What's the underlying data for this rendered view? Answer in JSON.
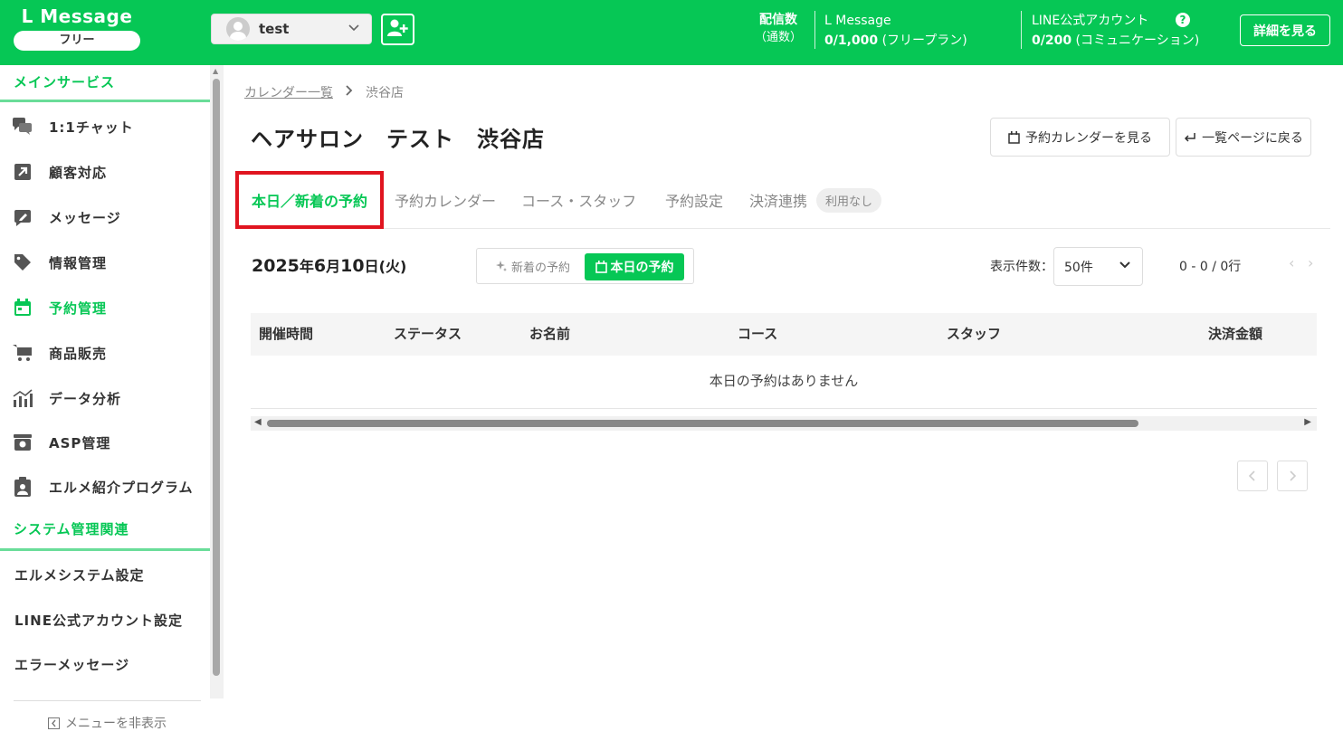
{
  "header": {
    "brand": "L Message",
    "plan": "フリー",
    "account": "test",
    "send_count_label_1": "配信数",
    "send_count_label_2": "（通数）",
    "lmessage_name": "L Message",
    "lmessage_value": "0/1,000",
    "lmessage_plan": "(フリープラン)",
    "line_name": "LINE公式アカウント",
    "line_value": "0/200",
    "line_plan": "(コミュニケーション)",
    "help": "?",
    "details_button": "詳細を見る"
  },
  "sidebar": {
    "main_section": "メインサービス",
    "items": [
      {
        "label": "1:1チャット",
        "icon": "chat-icon"
      },
      {
        "label": "顧客対応",
        "icon": "arrow-up-right-icon"
      },
      {
        "label": "メッセージ",
        "icon": "message-edit-icon"
      },
      {
        "label": "情報管理",
        "icon": "tag-icon"
      },
      {
        "label": "予約管理",
        "icon": "calendar-icon",
        "active": true
      },
      {
        "label": "商品販売",
        "icon": "cart-icon"
      },
      {
        "label": "データ分析",
        "icon": "chart-icon"
      },
      {
        "label": "ASP管理",
        "icon": "asp-icon"
      },
      {
        "label": "エルメ紹介プログラム",
        "icon": "clipboard-user-icon"
      }
    ],
    "system_section": "システム管理関連",
    "system_items": [
      "エルメシステム設定",
      "LINE公式アカウント設定",
      "エラーメッセージ"
    ],
    "hide_menu": "メニューを非表示"
  },
  "main": {
    "breadcrumb_link": "カレンダー一覧",
    "breadcrumb_current": "渋谷店",
    "title": "ヘアサロン　テスト　渋谷店",
    "view_calendar_button": "予約カレンダーを見る",
    "back_button": "一覧ページに戻る",
    "tabs": [
      "本日／新着の予約",
      "予約カレンダー",
      "コース・スタッフ",
      "予約設定",
      "決済連携"
    ],
    "payment_badge": "利用なし",
    "date_year": "2025",
    "date_year_unit": "年",
    "date_month": "6",
    "date_month_unit": "月",
    "date_day": "10",
    "date_day_unit": "日",
    "date_weekday": "(火)",
    "toggle_new": "新着の予約",
    "toggle_today": "本日の予約",
    "per_page_label": "表示件数：",
    "per_page_value": "50件",
    "range": "0 - 0 / 0行",
    "table_headers": [
      "開催時間",
      "ステータス",
      "お名前",
      "コース",
      "スタッフ",
      "決済金額"
    ],
    "empty_message": "本日の予約はありません"
  },
  "colors": {
    "brand_green": "#06c755",
    "highlight_red": "#e0141f"
  }
}
